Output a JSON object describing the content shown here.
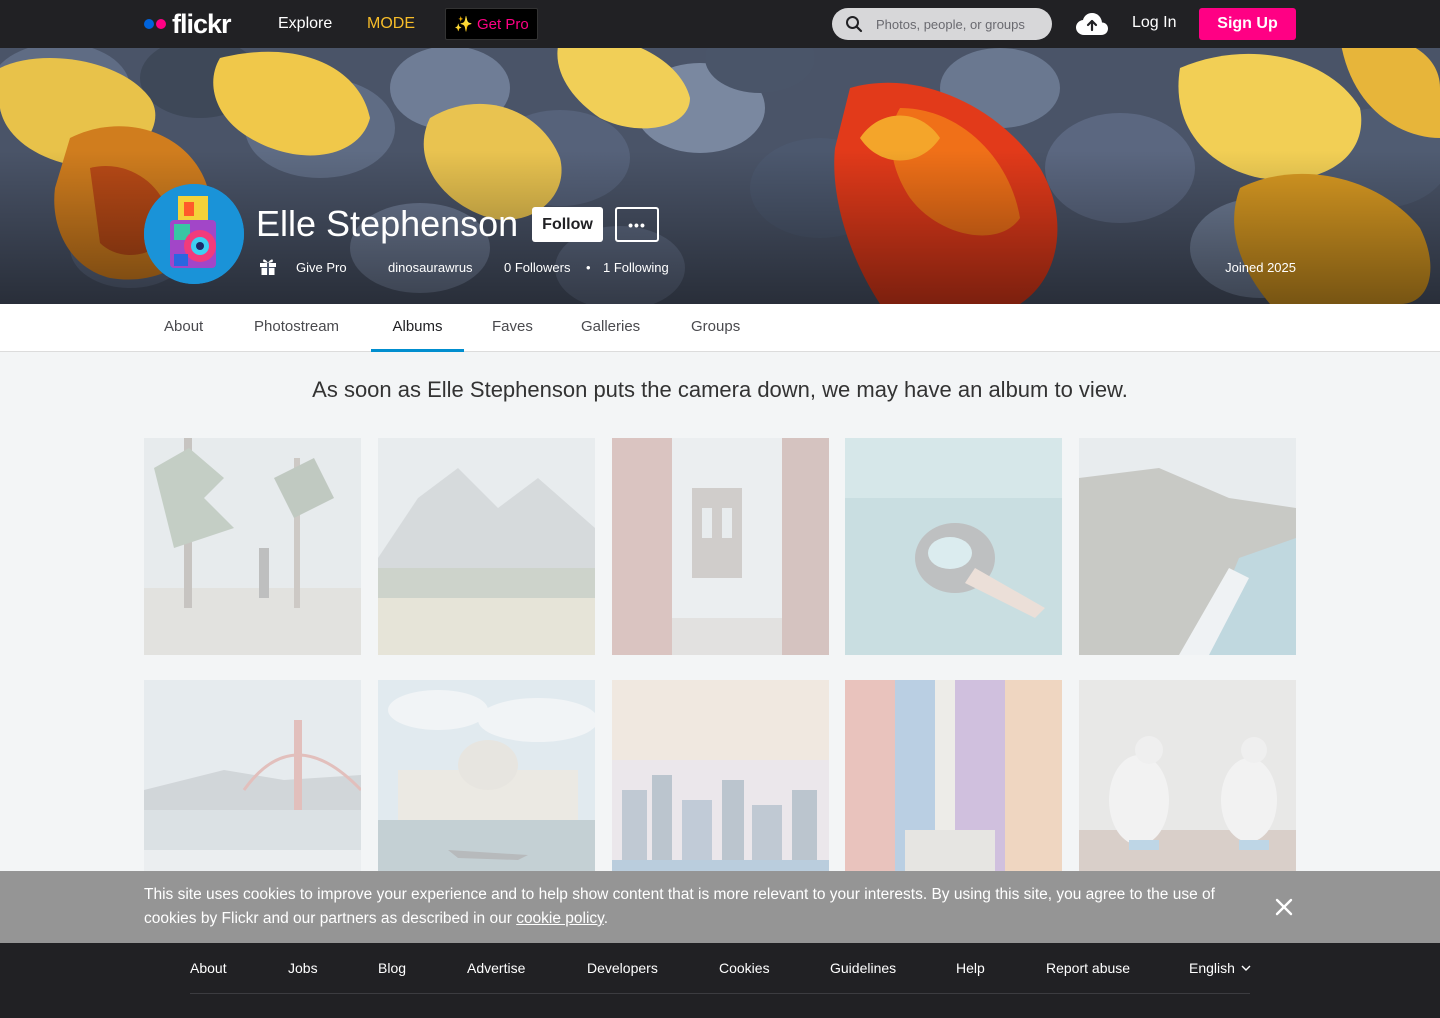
{
  "header": {
    "logo_text": "flickr",
    "nav": {
      "explore": "Explore",
      "mode": "MODE"
    },
    "get_pro": "Get Pro",
    "search_placeholder": "Photos, people, or groups",
    "login": "Log In",
    "signup": "Sign Up"
  },
  "profile": {
    "name": "Elle Stephenson",
    "follow": "Follow",
    "more": "•••",
    "give_pro": "Give Pro",
    "username": "dinosaurawrus",
    "followers": "0 Followers",
    "separator": "•",
    "following": "1 Following",
    "joined": "Joined 2025"
  },
  "tabs": [
    {
      "label": "About"
    },
    {
      "label": "Photostream"
    },
    {
      "label": "Albums"
    },
    {
      "label": "Faves"
    },
    {
      "label": "Galleries"
    },
    {
      "label": "Groups"
    }
  ],
  "active_tab": "Albums",
  "empty_message": "As soon as Elle Stephenson puts the camera down, we may have an album to view.",
  "cookie": {
    "text": "This site uses cookies to improve your experience and to help show content that is more relevant to your interests. By using this site, you agree to the use of cookies by Flickr and our partners as described in our ",
    "link": "cookie policy",
    "end": "."
  },
  "footer": {
    "links": [
      "About",
      "Jobs",
      "Blog",
      "Advertise",
      "Developers",
      "Cookies",
      "Guidelines",
      "Help",
      "Report abuse"
    ],
    "language": "English"
  },
  "colors": {
    "brand_pink": "#ff0084",
    "brand_blue": "#0063dc",
    "mode_yellow": "#f7bd29",
    "active_tab_underline": "#008ecf",
    "topbar": "#212124"
  },
  "icons": [
    "search-icon",
    "upload-cloud-icon",
    "gift-icon",
    "close-icon",
    "chevron-down-icon",
    "sparkle-icon"
  ]
}
